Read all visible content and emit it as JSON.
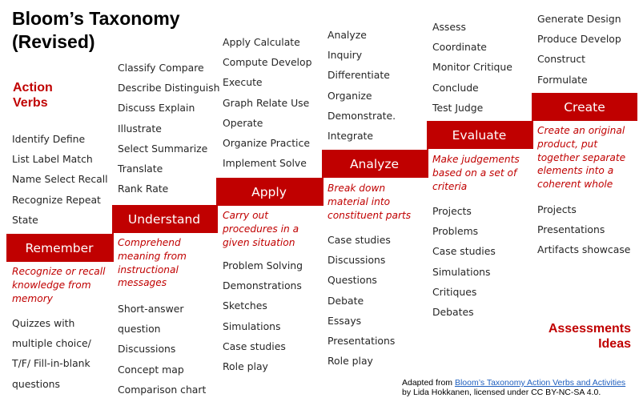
{
  "title_line1": "Bloom’s Taxonomy",
  "title_line2": "(Revised)",
  "action_verbs_label": [
    "Action",
    "Verbs"
  ],
  "assessments_label": [
    "Assessments",
    "Ideas"
  ],
  "accent_color": "#c00000",
  "levels": [
    {
      "name": "Remember",
      "verbs": [
        "Identify  Define",
        "List  Label  Match",
        "Name  Select  Recall",
        "Recognize Repeat",
        "State"
      ],
      "description": [
        "Recognize or recall",
        "knowledge from",
        "memory"
      ],
      "assessments": [
        "Quizzes with",
        "multiple choice/",
        "T/F/ Fill-in-blank",
        "questions"
      ]
    },
    {
      "name": "Understand",
      "verbs": [
        "Classify   Compare",
        "Describe Distinguish",
        "Discuss  Explain",
        "Illustrate",
        "Select  Summarize",
        "Translate",
        "Rank Rate"
      ],
      "description": [
        "Comprehend",
        "meaning from",
        "instructional",
        "messages"
      ],
      "assessments": [
        "Short-answer",
        "question",
        "Discussions",
        "Concept  map",
        "Comparison  chart"
      ]
    },
    {
      "name": "Apply",
      "verbs": [
        "Apply Calculate",
        "Compute   Develop",
        "Execute",
        "Graph  Relate Use",
        "Operate",
        "Organize Practice",
        "Implement  Solve"
      ],
      "description": [
        "Carry out",
        "procedures in a",
        "given situation"
      ],
      "assessments": [
        "Problem  Solving",
        "Demonstrations",
        "Sketches",
        "Simulations",
        "Case studies",
        "Role play"
      ]
    },
    {
      "name": "Analyze",
      "verbs": [
        "Analyze",
        "Inquiry",
        "Differentiate",
        "Organize",
        "Demonstrate.",
        "Integrate"
      ],
      "description": [
        "Break down",
        "material into",
        "constituent parts"
      ],
      "assessments": [
        "Case studies",
        "Discussions",
        "Questions",
        "Debate",
        "Essays",
        "Presentations",
        "Role play"
      ]
    },
    {
      "name": "Evaluate",
      "verbs": [
        "Assess",
        "Coordinate",
        "Monitor  Critique",
        "Conclude",
        "Test Judge"
      ],
      "description": [
        "Make judgements",
        "based  on a set  of",
        "criteria"
      ],
      "assessments": [
        "Projects",
        "Problems",
        "Case studies",
        "Simulations",
        "Critiques",
        "Debates"
      ]
    },
    {
      "name": "Create",
      "verbs": [
        "Generate  Design",
        "Produce  Develop",
        "Construct",
        "Formulate"
      ],
      "description": [
        "Create an original",
        "product, put",
        "together separate",
        "elements into a",
        "coherent whole"
      ],
      "assessments": [
        "Projects",
        "Presentations",
        "Artifacts showcase"
      ]
    }
  ],
  "footer": {
    "prefix": "Adapted from ",
    "link_text": "Bloom’s  Taxonomy Action Verbs and Activities ",
    "suffix": "by Lida Hokkanen, licensed under CC BY-NC-SA 4.0."
  }
}
